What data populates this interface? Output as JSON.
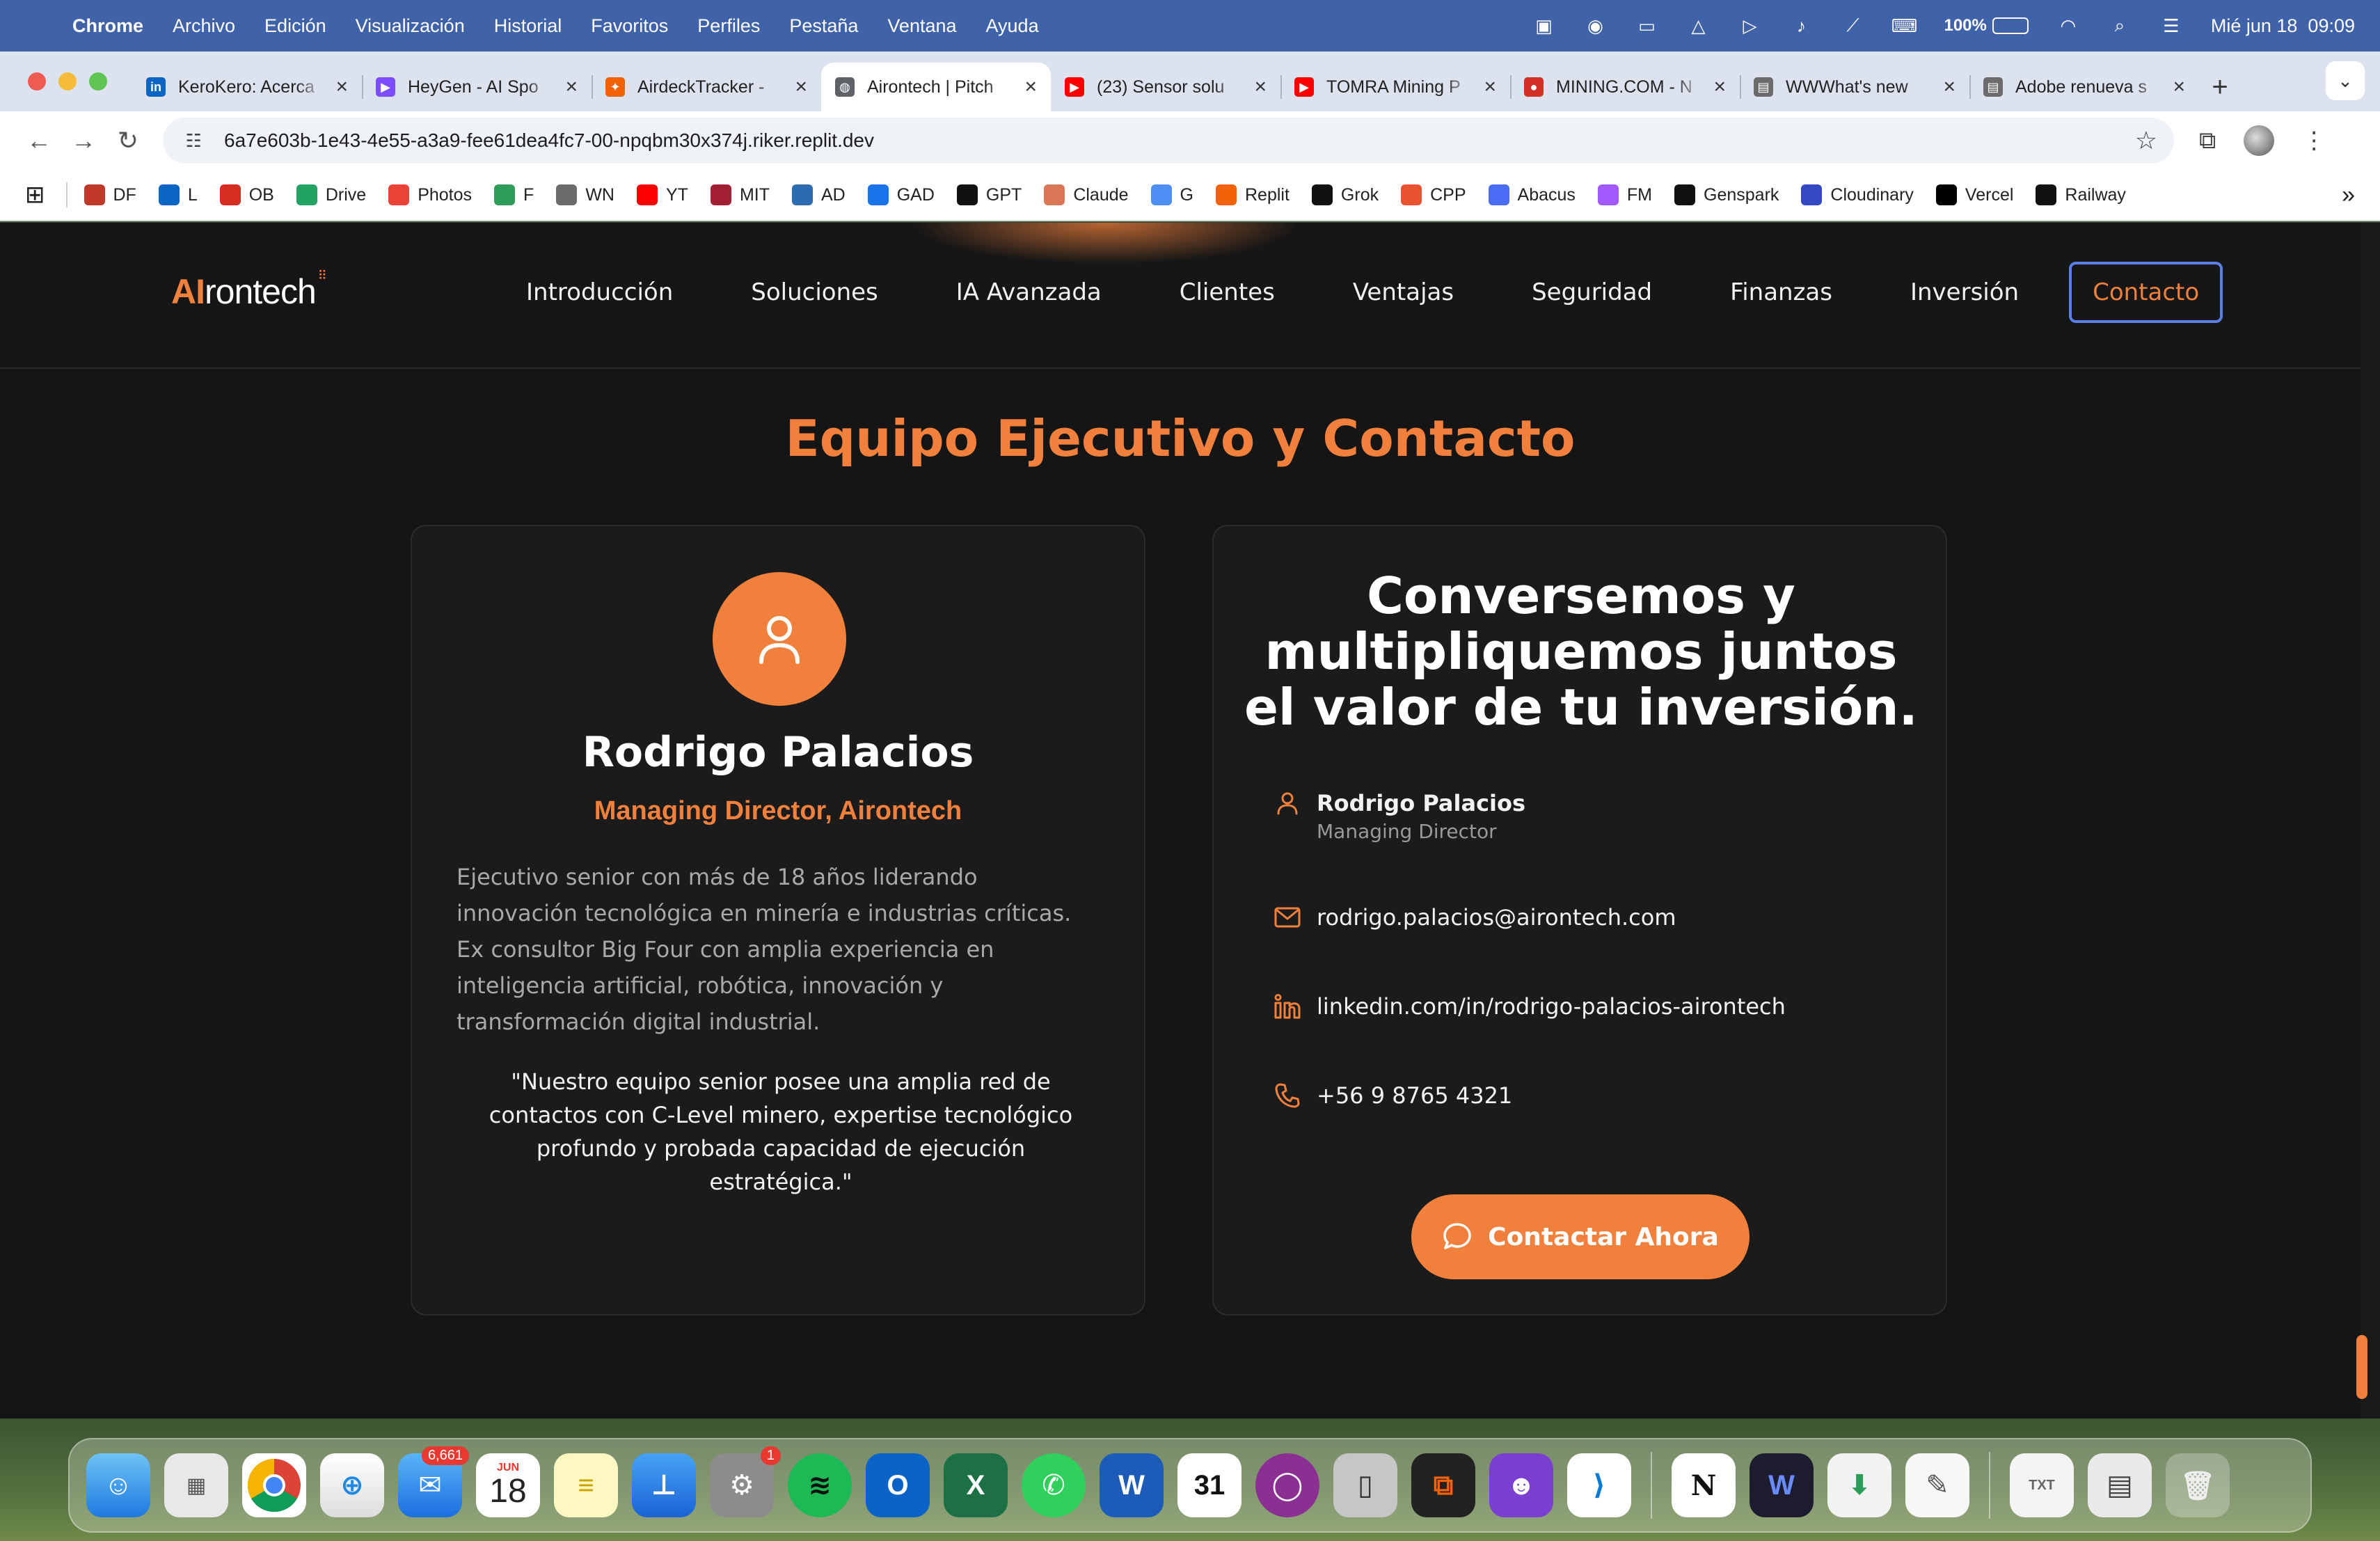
{
  "menubar": {
    "app_name": "Chrome",
    "items": [
      "Archivo",
      "Edición",
      "Visualización",
      "Historial",
      "Favoritos",
      "Perfiles",
      "Pestaña",
      "Ventana",
      "Ayuda"
    ],
    "battery": "100%",
    "datetime": "Mié jun 18  09:09"
  },
  "tabs": [
    {
      "title": "KeroKero: Acerca",
      "color": "#0a66c2",
      "glyph": "in"
    },
    {
      "title": "HeyGen - AI Spo",
      "color": "#7b4dff",
      "glyph": "▶"
    },
    {
      "title": "AirdeckTracker -",
      "color": "#f26207",
      "glyph": "✦"
    },
    {
      "title": "Airontech | Pitch",
      "color": "#5f6368",
      "glyph": "◍",
      "active": true
    },
    {
      "title": "(23) Sensor solu",
      "color": "#ff0000",
      "glyph": "▶"
    },
    {
      "title": "TOMRA Mining P",
      "color": "#ff0000",
      "glyph": "▶"
    },
    {
      "title": "MINING.COM - N",
      "color": "#d22f27",
      "glyph": "●"
    },
    {
      "title": "WWWhat's new",
      "color": "#6b6b6b",
      "glyph": "▤"
    },
    {
      "title": "Adobe renueva s",
      "color": "#6b6b6b",
      "glyph": "▤"
    }
  ],
  "omnibox": {
    "url": "6a7e603b-1e43-4e55-a3a9-fee61dea4fc7-00-npqbm30x374j.riker.replit.dev"
  },
  "bookmarks": [
    {
      "label": "DF",
      "color": "#c0392b"
    },
    {
      "label": "L",
      "color": "#0a66c2"
    },
    {
      "label": "OB",
      "color": "#d62d20"
    },
    {
      "label": "Drive",
      "color": "#1fa463"
    },
    {
      "label": "Photos",
      "color": "#ea4335"
    },
    {
      "label": "F",
      "color": "#2e9d5b"
    },
    {
      "label": "WN",
      "color": "#6b6b6b"
    },
    {
      "label": "YT",
      "color": "#ff0000"
    },
    {
      "label": "MIT",
      "color": "#a31f34"
    },
    {
      "label": "AD",
      "color": "#2b6cb0"
    },
    {
      "label": "GAD",
      "color": "#1a73e8"
    },
    {
      "label": "GPT",
      "color": "#111111"
    },
    {
      "label": "Claude",
      "color": "#d97757"
    },
    {
      "label": "G",
      "color": "#4f8ef7"
    },
    {
      "label": "Replit",
      "color": "#f26207"
    },
    {
      "label": "Grok",
      "color": "#111111"
    },
    {
      "label": "CPP",
      "color": "#e8542f"
    },
    {
      "label": "Abacus",
      "color": "#4a6cf7"
    },
    {
      "label": "FM",
      "color": "#a259ff"
    },
    {
      "label": "Genspark",
      "color": "#111111"
    },
    {
      "label": "Cloudinary",
      "color": "#3448c5"
    },
    {
      "label": "Vercel",
      "color": "#000000"
    },
    {
      "label": "Railway",
      "color": "#111111"
    }
  ],
  "site": {
    "logo_ai": "AI",
    "logo_rest": "rontech",
    "nav": [
      "Introducción",
      "Soluciones",
      "IA Avanzada",
      "Clientes",
      "Ventajas",
      "Seguridad",
      "Finanzas",
      "Inversión"
    ],
    "nav_active": "Contacto",
    "accent": "#f0803c"
  },
  "section": {
    "title": "Equipo Ejecutivo y Contacto"
  },
  "profile": {
    "name": "Rodrigo Palacios",
    "role": "Managing Director, Airontech",
    "bio": "Ejecutivo senior con más de 18 años liderando innovación tecnológica en minería e industrias críticas. Ex consultor Big Four con amplia experiencia en inteligencia artificial, robótica, innovación y transformación digital industrial.",
    "quote": "\"Nuestro equipo senior posee una amplia red de contactos con C-Level minero, expertise tecnológico profundo y probada capacidad de ejecución estratégica.\""
  },
  "contact": {
    "heading": "Conversemos y multipliquemos juntos el valor de tu inversión.",
    "name": "Rodrigo Palacios",
    "title": "Managing Director",
    "email": "rodrigo.palacios@airontech.com",
    "linkedin": "linkedin.com/in/rodrigo-palacios-airontech",
    "phone": "+56 9 8765 4321",
    "cta_label": "Contactar Ahora"
  },
  "dock": {
    "mail_badge": "6,661",
    "calendar_month": "JUN",
    "calendar_day": "18",
    "settings_badge": "1"
  }
}
